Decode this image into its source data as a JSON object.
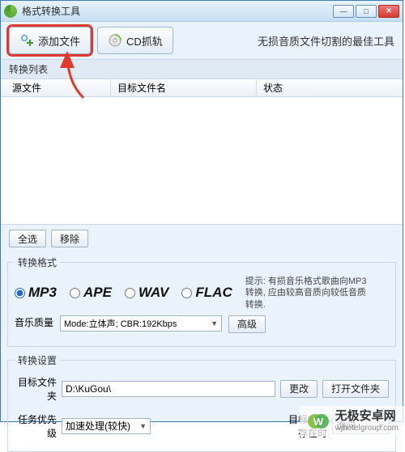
{
  "window": {
    "title": "格式转换工具"
  },
  "toolbar": {
    "add_file": "添加文件",
    "cd_rip": "CD抓轨",
    "tagline": "无损音质文件切割的最佳工具"
  },
  "list": {
    "header": "转换列表",
    "columns": {
      "src": "源文件",
      "dst": "目标文件名",
      "status": "状态"
    },
    "select_all": "全选",
    "remove": "移除"
  },
  "format": {
    "legend": "转换格式",
    "options": [
      "MP3",
      "APE",
      "WAV",
      "FLAC"
    ],
    "selected": "MP3",
    "quality_label": "音乐质量",
    "quality_value": "Mode:立体声; CBR:192Kbps",
    "advanced": "高级",
    "tip_label": "提示:",
    "tip_text": "有损音乐格式歌曲向MP3转换, 应由较高音质向较低音质转换."
  },
  "settings": {
    "legend": "转换设置",
    "target_folder_label": "目标文件夹",
    "target_folder_value": "D:\\KuGou\\",
    "change": "更改",
    "open_folder": "打开文件夹",
    "priority_label": "任务优先级",
    "priority_value": "加速处理(较快)",
    "exists_label": "目标文件存在时",
    "exists_value": "询问"
  },
  "watermark": {
    "name": "无极安卓网",
    "url": "wjhotelgroup.com"
  }
}
